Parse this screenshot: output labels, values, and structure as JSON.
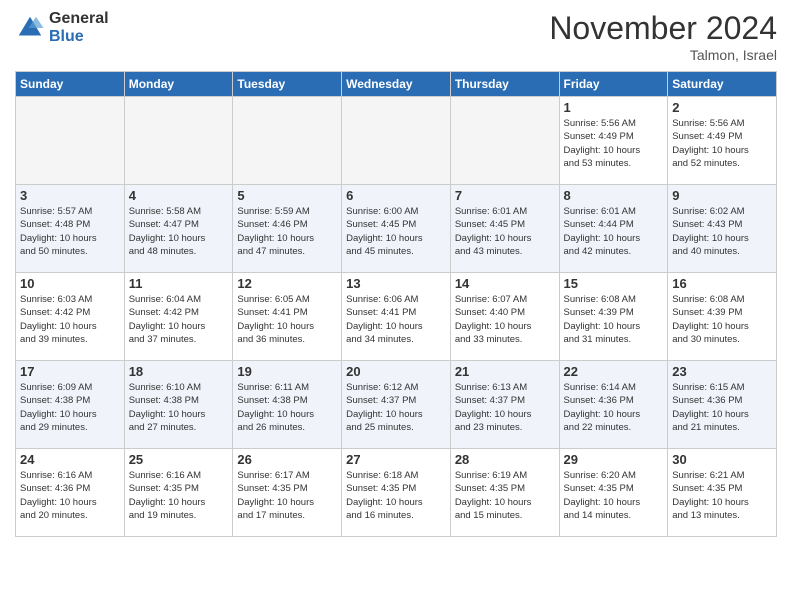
{
  "header": {
    "logo_general": "General",
    "logo_blue": "Blue",
    "month_title": "November 2024",
    "subtitle": "Talmon, Israel"
  },
  "days_of_week": [
    "Sunday",
    "Monday",
    "Tuesday",
    "Wednesday",
    "Thursday",
    "Friday",
    "Saturday"
  ],
  "weeks": [
    [
      {
        "day": "",
        "info": ""
      },
      {
        "day": "",
        "info": ""
      },
      {
        "day": "",
        "info": ""
      },
      {
        "day": "",
        "info": ""
      },
      {
        "day": "",
        "info": ""
      },
      {
        "day": "1",
        "info": "Sunrise: 5:56 AM\nSunset: 4:49 PM\nDaylight: 10 hours\nand 53 minutes."
      },
      {
        "day": "2",
        "info": "Sunrise: 5:56 AM\nSunset: 4:49 PM\nDaylight: 10 hours\nand 52 minutes."
      }
    ],
    [
      {
        "day": "3",
        "info": "Sunrise: 5:57 AM\nSunset: 4:48 PM\nDaylight: 10 hours\nand 50 minutes."
      },
      {
        "day": "4",
        "info": "Sunrise: 5:58 AM\nSunset: 4:47 PM\nDaylight: 10 hours\nand 48 minutes."
      },
      {
        "day": "5",
        "info": "Sunrise: 5:59 AM\nSunset: 4:46 PM\nDaylight: 10 hours\nand 47 minutes."
      },
      {
        "day": "6",
        "info": "Sunrise: 6:00 AM\nSunset: 4:45 PM\nDaylight: 10 hours\nand 45 minutes."
      },
      {
        "day": "7",
        "info": "Sunrise: 6:01 AM\nSunset: 4:45 PM\nDaylight: 10 hours\nand 43 minutes."
      },
      {
        "day": "8",
        "info": "Sunrise: 6:01 AM\nSunset: 4:44 PM\nDaylight: 10 hours\nand 42 minutes."
      },
      {
        "day": "9",
        "info": "Sunrise: 6:02 AM\nSunset: 4:43 PM\nDaylight: 10 hours\nand 40 minutes."
      }
    ],
    [
      {
        "day": "10",
        "info": "Sunrise: 6:03 AM\nSunset: 4:42 PM\nDaylight: 10 hours\nand 39 minutes."
      },
      {
        "day": "11",
        "info": "Sunrise: 6:04 AM\nSunset: 4:42 PM\nDaylight: 10 hours\nand 37 minutes."
      },
      {
        "day": "12",
        "info": "Sunrise: 6:05 AM\nSunset: 4:41 PM\nDaylight: 10 hours\nand 36 minutes."
      },
      {
        "day": "13",
        "info": "Sunrise: 6:06 AM\nSunset: 4:41 PM\nDaylight: 10 hours\nand 34 minutes."
      },
      {
        "day": "14",
        "info": "Sunrise: 6:07 AM\nSunset: 4:40 PM\nDaylight: 10 hours\nand 33 minutes."
      },
      {
        "day": "15",
        "info": "Sunrise: 6:08 AM\nSunset: 4:39 PM\nDaylight: 10 hours\nand 31 minutes."
      },
      {
        "day": "16",
        "info": "Sunrise: 6:08 AM\nSunset: 4:39 PM\nDaylight: 10 hours\nand 30 minutes."
      }
    ],
    [
      {
        "day": "17",
        "info": "Sunrise: 6:09 AM\nSunset: 4:38 PM\nDaylight: 10 hours\nand 29 minutes."
      },
      {
        "day": "18",
        "info": "Sunrise: 6:10 AM\nSunset: 4:38 PM\nDaylight: 10 hours\nand 27 minutes."
      },
      {
        "day": "19",
        "info": "Sunrise: 6:11 AM\nSunset: 4:38 PM\nDaylight: 10 hours\nand 26 minutes."
      },
      {
        "day": "20",
        "info": "Sunrise: 6:12 AM\nSunset: 4:37 PM\nDaylight: 10 hours\nand 25 minutes."
      },
      {
        "day": "21",
        "info": "Sunrise: 6:13 AM\nSunset: 4:37 PM\nDaylight: 10 hours\nand 23 minutes."
      },
      {
        "day": "22",
        "info": "Sunrise: 6:14 AM\nSunset: 4:36 PM\nDaylight: 10 hours\nand 22 minutes."
      },
      {
        "day": "23",
        "info": "Sunrise: 6:15 AM\nSunset: 4:36 PM\nDaylight: 10 hours\nand 21 minutes."
      }
    ],
    [
      {
        "day": "24",
        "info": "Sunrise: 6:16 AM\nSunset: 4:36 PM\nDaylight: 10 hours\nand 20 minutes."
      },
      {
        "day": "25",
        "info": "Sunrise: 6:16 AM\nSunset: 4:35 PM\nDaylight: 10 hours\nand 19 minutes."
      },
      {
        "day": "26",
        "info": "Sunrise: 6:17 AM\nSunset: 4:35 PM\nDaylight: 10 hours\nand 17 minutes."
      },
      {
        "day": "27",
        "info": "Sunrise: 6:18 AM\nSunset: 4:35 PM\nDaylight: 10 hours\nand 16 minutes."
      },
      {
        "day": "28",
        "info": "Sunrise: 6:19 AM\nSunset: 4:35 PM\nDaylight: 10 hours\nand 15 minutes."
      },
      {
        "day": "29",
        "info": "Sunrise: 6:20 AM\nSunset: 4:35 PM\nDaylight: 10 hours\nand 14 minutes."
      },
      {
        "day": "30",
        "info": "Sunrise: 6:21 AM\nSunset: 4:35 PM\nDaylight: 10 hours\nand 13 minutes."
      }
    ]
  ]
}
